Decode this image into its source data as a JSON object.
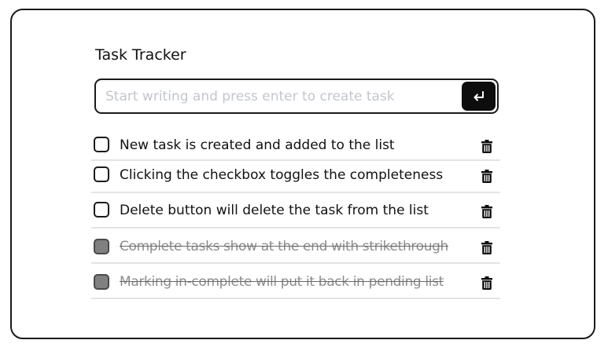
{
  "app": {
    "title": "Task Tracker"
  },
  "input": {
    "placeholder": "Start writing and press enter to create task",
    "value": "",
    "submit_icon": "enter-icon"
  },
  "tasks": [
    {
      "label": "New task is created and added to the list",
      "completed": false
    },
    {
      "label": "Clicking the checkbox toggles the completeness",
      "completed": false
    },
    {
      "label": "Delete button will delete the task from the list",
      "completed": false
    },
    {
      "label": "Complete tasks show at the end with strikethrough",
      "completed": true
    },
    {
      "label": "Marking in-complete will put it back in pending list",
      "completed": true
    }
  ],
  "icons": {
    "delete": "trash-icon"
  },
  "colors": {
    "border": "#1a1a1a",
    "button_bg": "#0d0d0d",
    "completed_checkbox": "#808080",
    "completed_text": "#8c8c8c",
    "placeholder": "#c2c6cc",
    "divider": "#e4e4e4"
  }
}
